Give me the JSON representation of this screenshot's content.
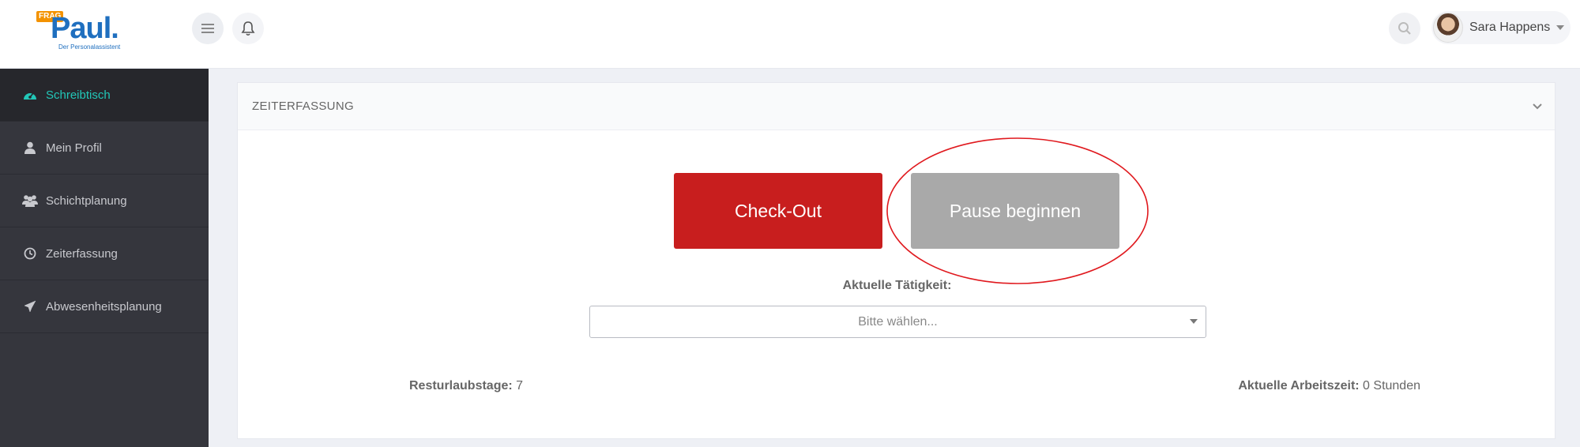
{
  "logo": {
    "badge": "FRAG",
    "name": "Paul.",
    "tagline": "Der Personalassistent"
  },
  "header": {
    "user_name": "Sara Happens"
  },
  "sidebar": {
    "items": [
      {
        "label": "Schreibtisch",
        "icon": "dashboard-icon",
        "active": true
      },
      {
        "label": "Mein Profil",
        "icon": "user-icon"
      },
      {
        "label": "Schichtplanung",
        "icon": "users-icon"
      },
      {
        "label": "Zeiterfassung",
        "icon": "clock-icon"
      },
      {
        "label": "Abwesenheitsplanung",
        "icon": "plane-icon"
      }
    ]
  },
  "panel": {
    "title": "ZEITERFASSUNG",
    "checkout_label": "Check-Out",
    "pause_label": "Pause beginnen",
    "activity_label": "Aktuelle Tätigkeit:",
    "activity_placeholder": "Bitte wählen...",
    "vacation_label": "Resturlaubstage:",
    "vacation_value": "7",
    "worktime_label": "Aktuelle Arbeitszeit:",
    "worktime_value": "0 Stunden"
  },
  "colors": {
    "accent": "#22c7b8",
    "checkout": "#c81e1e",
    "pause": "#a9a9a9",
    "highlight_ring": "#e0191e",
    "sidebar_bg": "#35363d"
  }
}
